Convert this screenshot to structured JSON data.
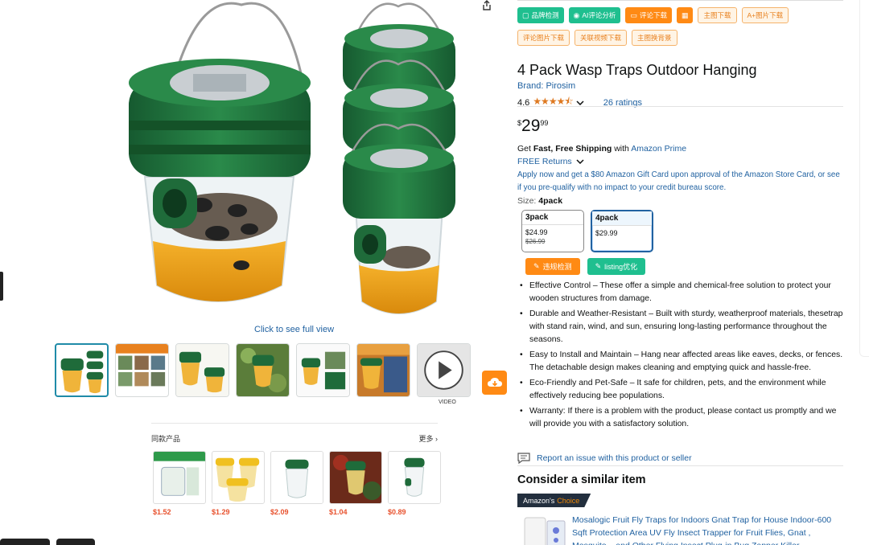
{
  "toolbar": {
    "row1": [
      {
        "label": "品牌检测",
        "style": "green",
        "icon": "▢"
      },
      {
        "label": "AI评论分析",
        "style": "green",
        "icon": "◉"
      },
      {
        "label": "评论下载",
        "style": "orange",
        "icon": "▭"
      },
      {
        "label": "",
        "style": "orange",
        "icon": "▦"
      },
      {
        "label": "主图下载",
        "style": "outline",
        "icon": ""
      },
      {
        "label": "A+图片下载",
        "style": "outline",
        "icon": ""
      }
    ],
    "row2": [
      {
        "label": "评论图片下载",
        "style": "outline"
      },
      {
        "label": "关联视频下载",
        "style": "outline"
      },
      {
        "label": "主图换背景",
        "style": "outline"
      }
    ],
    "lower": [
      {
        "label": "违规检测",
        "color": "#ff8a14"
      },
      {
        "label": "listing优化",
        "color": "#1fbf8f"
      }
    ]
  },
  "product": {
    "title": "4 Pack Wasp Traps Outdoor Hanging",
    "brand": "Brand: Pirosim",
    "rating": "4.6",
    "stars": "★★★★⯪",
    "ratings_count": "26 ratings",
    "price_symbol": "$",
    "price_whole": "29",
    "price_fraction": "99",
    "ship_prefix": "Get ",
    "ship_bold": "Fast, Free Shipping",
    "ship_mid": " with ",
    "ship_link": "Amazon Prime",
    "returns": "FREE Returns",
    "card_offer": "Apply now and get a $80 Amazon Gift Card upon approval of the Amazon Store Card, or see if you pre-qualify with no impact to your credit bureau score.",
    "size_label": "Size: ",
    "size_value": "4pack",
    "sizes": [
      {
        "name": "3pack",
        "price": "$24.99",
        "old_price": "$26.99"
      },
      {
        "name": "4pack",
        "price": "$29.99",
        "old_price": ""
      }
    ],
    "bullets": [
      "Effective Control – These offer a simple and chemical-free solution to protect your wooden structures from damage.",
      "Durable and Weather-Resistant – Built with sturdy, weatherproof materials, thesetrap with stand rain, wind, and sun, ensuring long-lasting performance throughout the seasons.",
      "Easy to Install and Maintain – Hang near affected areas like eaves, decks, or fences. The detachable design makes cleaning and emptying quick and hassle-free.",
      "Eco-Friendly and Pet-Safe – It safe for children, pets, and the environment while effectively reducing bee populations.",
      "Warranty: If there is a problem with the product, please contact us promptly and we will provide you with a satisfactory solution."
    ],
    "report": "Report an issue with this product or seller"
  },
  "gallery": {
    "click_full": "Click to see full view",
    "video_label": "VIDEO"
  },
  "similar_strip": {
    "title": "同款产品",
    "more": "更多",
    "prices": [
      "$1.52",
      "$1.29",
      "$2.09",
      "$1.04",
      "$0.89"
    ]
  },
  "consider": {
    "heading": "Consider a similar item",
    "badge_prefix": "Amazon's",
    "badge_choice": "Choice",
    "item_title": "Mosalogic Fruit Fly Traps for Indoors Gnat Trap for House Indoor-600 Sqft Protection Area UV Fly Insect Trapper for Fruit Flies, Gnat , Mosquito, , and Other Flying Insect Plug-in Bug Zapper Killer"
  },
  "colors": {
    "link": "#2162a1",
    "star": "#de7921",
    "green_btn": "#1fbf8f",
    "orange_btn": "#ff8a14",
    "trap_lid": "#1f6b3a"
  }
}
